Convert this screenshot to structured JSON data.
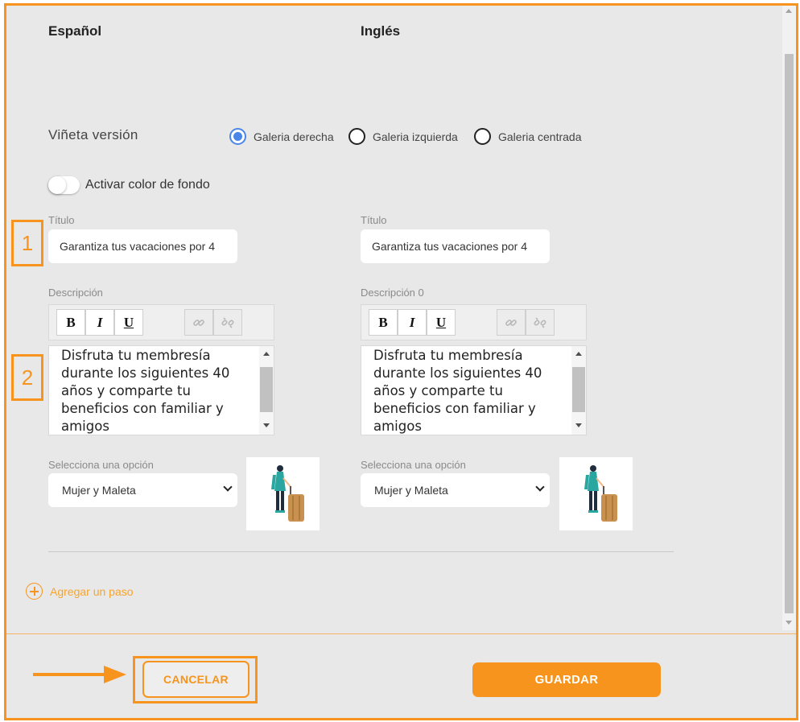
{
  "columns": {
    "left_heading": "Español",
    "right_heading": "Inglés"
  },
  "vineta": {
    "label": "Viñeta versión",
    "options": [
      {
        "label": "Galeria derecha",
        "selected": true
      },
      {
        "label": "Galeria izquierda",
        "selected": false
      },
      {
        "label": "Galeria centrada",
        "selected": false
      }
    ]
  },
  "background_toggle": {
    "label": "Activar color de fondo",
    "enabled": false
  },
  "spanish": {
    "title_label": "Título",
    "title_value": "Garantiza tus vacaciones por 4",
    "description_label": "Descripción",
    "description_text": "Disfruta tu membresía durante los siguientes 40 años y comparte tu beneficios con familiar y amigos",
    "select_label": "Selecciona una opción",
    "select_value": "Mujer y Maleta"
  },
  "english": {
    "title_label": "Título",
    "title_value": "Garantiza tus vacaciones por 4",
    "description_label": "Descripción 0",
    "description_text": "Disfruta tu membresía durante los siguientes 40 años y comparte tu beneficios con familiar y amigos",
    "select_label": "Selecciona una opción",
    "select_value": "Mujer y Maleta"
  },
  "toolbar": {
    "bold": "B",
    "italic": "I",
    "underline": "U"
  },
  "add_step": {
    "label": "Agregar un paso"
  },
  "footer": {
    "cancel_label": "CANCELAR",
    "save_label": "GUARDAR"
  },
  "markers": {
    "marker_1": "1",
    "marker_2": "2"
  },
  "colors": {
    "accent": "#f7941d",
    "radio_selected": "#4a86e8",
    "panel_bg": "#e8e8e8"
  },
  "icons": [
    "link-icon",
    "unlink-icon",
    "plus-circle-icon",
    "chevron-down-icon",
    "arrow-right-icon"
  ]
}
